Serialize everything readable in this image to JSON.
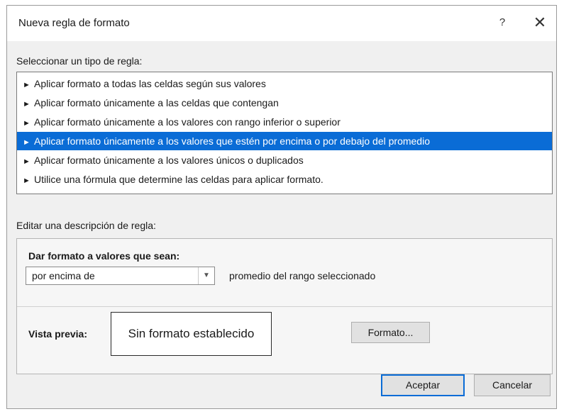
{
  "dialog": {
    "title": "Nueva regla de formato",
    "help_label": "?",
    "close_label": "✕"
  },
  "rule_types": {
    "label": "Seleccionar un tipo de regla:",
    "arrow": "►",
    "items": [
      {
        "label": "Aplicar formato a todas las celdas según sus valores",
        "selected": false
      },
      {
        "label": "Aplicar formato únicamente a las celdas que contengan",
        "selected": false
      },
      {
        "label": "Aplicar formato únicamente a los valores con rango inferior o superior",
        "selected": false
      },
      {
        "label": "Aplicar formato únicamente a los valores que estén por encima o por debajo del promedio",
        "selected": true
      },
      {
        "label": "Aplicar formato únicamente a los valores únicos o duplicados",
        "selected": false
      },
      {
        "label": "Utilice una fórmula que determine las celdas para aplicar formato.",
        "selected": false
      }
    ]
  },
  "description": {
    "label": "Editar una descripción de regla:",
    "heading": "Dar formato a valores que sean:",
    "combo_value": "por encima de",
    "combo_suffix": "promedio del rango seleccionado",
    "preview_label": "Vista previa:",
    "preview_text": "Sin formato establecido",
    "format_button": "Formato..."
  },
  "buttons": {
    "ok": "Aceptar",
    "cancel": "Cancelar"
  },
  "colors": {
    "selection": "#0a6cd6"
  }
}
